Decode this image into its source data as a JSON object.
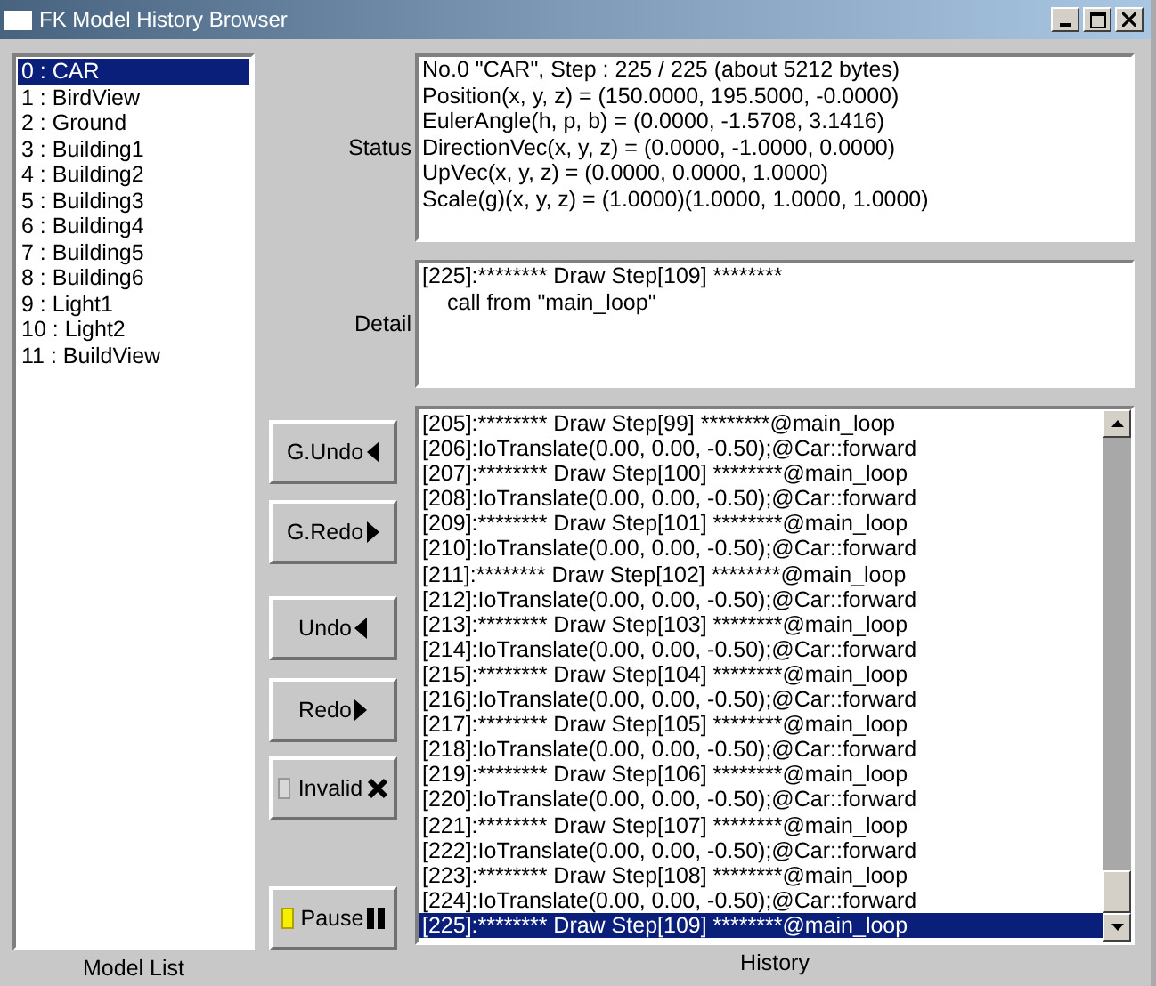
{
  "window": {
    "title": "FK Model History Browser"
  },
  "model_list": {
    "label": "Model List",
    "items": [
      {
        "text": "0 : CAR",
        "selected": true
      },
      {
        "text": "1 : BirdView",
        "selected": false
      },
      {
        "text": "2 : Ground",
        "selected": false
      },
      {
        "text": "3 : Building1",
        "selected": false
      },
      {
        "text": "4 : Building2",
        "selected": false
      },
      {
        "text": "5 : Building3",
        "selected": false
      },
      {
        "text": "6 : Building4",
        "selected": false
      },
      {
        "text": "7 : Building5",
        "selected": false
      },
      {
        "text": "8 : Building6",
        "selected": false
      },
      {
        "text": "9 : Light1",
        "selected": false
      },
      {
        "text": "10 : Light2",
        "selected": false
      },
      {
        "text": "11 : BuildView",
        "selected": false
      }
    ]
  },
  "status": {
    "label": "Status",
    "lines": [
      "No.0 \"CAR\", Step : 225 / 225 (about 5212 bytes)",
      "Position(x, y, z) = (150.0000, 195.5000, -0.0000)",
      "EulerAngle(h, p, b) = (0.0000, -1.5708, 3.1416)",
      "DirectionVec(x, y, z) = (0.0000, -1.0000, 0.0000)",
      "UpVec(x, y, z) = (0.0000, 0.0000, 1.0000)",
      "Scale(g)(x, y, z) = (1.0000)(1.0000, 1.0000, 1.0000)"
    ]
  },
  "detail": {
    "label": "Detail",
    "lines": [
      {
        "text": "[225]:******** Draw Step[109] ********",
        "indented": false
      },
      {
        "text": "call from \"main_loop\"",
        "indented": true
      }
    ]
  },
  "buttons": [
    {
      "kind": "plain",
      "label": "G.Undo"
    },
    {
      "kind": "plain",
      "label": "G.Redo"
    },
    {
      "kind": "plain",
      "label": "Undo"
    },
    {
      "kind": "plain",
      "label": "Redo"
    },
    {
      "kind": "indicator",
      "label": "Invalid",
      "on": false
    },
    {
      "kind": "indicator",
      "label": "Pause",
      "on": true
    }
  ],
  "history": {
    "label": "History",
    "items": [
      {
        "text": "[205]:******** Draw Step[99] ********@main_loop",
        "selected": false
      },
      {
        "text": "[206]:IoTranslate(0.00, 0.00, -0.50);@Car::forward",
        "selected": false
      },
      {
        "text": "[207]:******** Draw Step[100] ********@main_loop",
        "selected": false
      },
      {
        "text": "[208]:IoTranslate(0.00, 0.00, -0.50);@Car::forward",
        "selected": false
      },
      {
        "text": "[209]:******** Draw Step[101] ********@main_loop",
        "selected": false
      },
      {
        "text": "[210]:IoTranslate(0.00, 0.00, -0.50);@Car::forward",
        "selected": false
      },
      {
        "text": "[211]:******** Draw Step[102] ********@main_loop",
        "selected": false
      },
      {
        "text": "[212]:IoTranslate(0.00, 0.00, -0.50);@Car::forward",
        "selected": false
      },
      {
        "text": "[213]:******** Draw Step[103] ********@main_loop",
        "selected": false
      },
      {
        "text": "[214]:IoTranslate(0.00, 0.00, -0.50);@Car::forward",
        "selected": false
      },
      {
        "text": "[215]:******** Draw Step[104] ********@main_loop",
        "selected": false
      },
      {
        "text": "[216]:IoTranslate(0.00, 0.00, -0.50);@Car::forward",
        "selected": false
      },
      {
        "text": "[217]:******** Draw Step[105] ********@main_loop",
        "selected": false
      },
      {
        "text": "[218]:IoTranslate(0.00, 0.00, -0.50);@Car::forward",
        "selected": false
      },
      {
        "text": "[219]:******** Draw Step[106] ********@main_loop",
        "selected": false
      },
      {
        "text": "[220]:IoTranslate(0.00, 0.00, -0.50);@Car::forward",
        "selected": false
      },
      {
        "text": "[221]:******** Draw Step[107] ********@main_loop",
        "selected": false
      },
      {
        "text": "[222]:IoTranslate(0.00, 0.00, -0.50);@Car::forward",
        "selected": false
      },
      {
        "text": "[223]:******** Draw Step[108] ********@main_loop",
        "selected": false
      },
      {
        "text": "[224]:IoTranslate(0.00, 0.00, -0.50);@Car::forward",
        "selected": false
      },
      {
        "text": "[225]:******** Draw Step[109] ********@main_loop",
        "selected": true
      }
    ]
  }
}
